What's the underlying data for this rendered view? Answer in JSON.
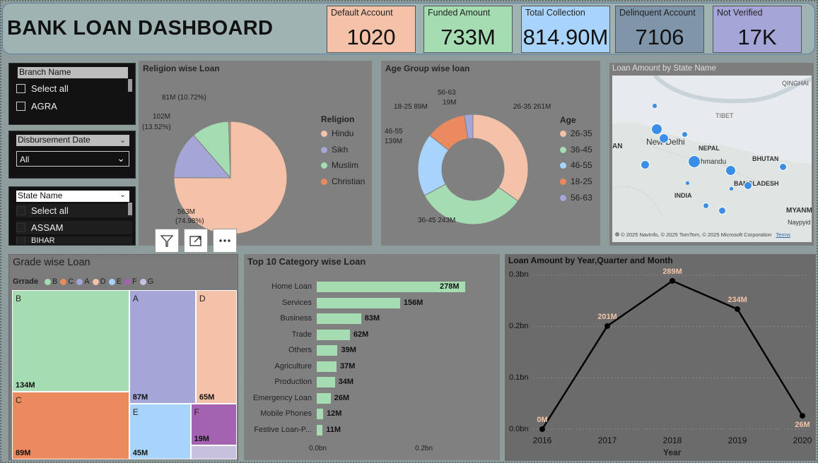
{
  "header": {
    "title": "BANK LOAN DASHBOARD"
  },
  "kpis": [
    {
      "label": "Default Account",
      "value": "1020",
      "color": "#f4c2a8"
    },
    {
      "label": "Funded Amount",
      "value": "733M",
      "color": "#a6dcb2"
    },
    {
      "label": "Total Collection",
      "value": "814.90M",
      "color": "#a8d4fb"
    },
    {
      "label": "Delinquent Account",
      "value": "7106",
      "color": "#7f95aa"
    },
    {
      "label": "Not Verified",
      "value": "17K",
      "color": "#a5a5d8"
    }
  ],
  "slicers": {
    "branch": {
      "header": "Branch Name",
      "items": [
        "Select all",
        "AGRA"
      ]
    },
    "date": {
      "header": "Disbursement Date",
      "value": "All"
    },
    "state": {
      "header": "State Name",
      "items": [
        "Select all",
        "ASSAM",
        "BIHAR"
      ]
    }
  },
  "religion_chart": {
    "title": "Religion wise Loan",
    "legend_title": "Religion",
    "labels": [
      "81M (10.72%)",
      "102M",
      "(13.52%)",
      "563M",
      "(74.98%)"
    ]
  },
  "age_chart": {
    "title": "Age Group wise loan",
    "legend_title": "Age",
    "labels": [
      "56-63",
      "19M",
      "18-25 89M",
      "26-35 261M",
      "46-55",
      "139M",
      "36-45 243M"
    ]
  },
  "map": {
    "title": "Loan Amount by State Name",
    "places": [
      "QINGHAI",
      "TIBET",
      "New Delhi",
      "NEPAL",
      "Kathmandu",
      "BHUTAN",
      "INDIA",
      "BANGLADESH",
      "Naypyid",
      "MYANM",
      "AN"
    ],
    "attribution": "© 2025 NavInfo, © 2025 TomTom, © 2025 Microsoft Corporation",
    "terms": "Terms"
  },
  "toolbar": {
    "filter": "filter-icon",
    "focus": "focus-mode-icon",
    "more": "more-options-icon"
  },
  "grade_chart": {
    "title": "Grade wise Loan",
    "legend_title": "Grrade"
  },
  "category_chart": {
    "title": "Top 10 Category wise Loan",
    "axis_ticks": [
      "0.0bn",
      "0.2bn"
    ]
  },
  "trend_chart": {
    "title": "Loan Amount by Year,Quarter and Month",
    "xlabel": "Year",
    "yticks": [
      "0.3bn",
      "0.2bn",
      "0.1bn",
      "0.0bn"
    ]
  },
  "chart_data": [
    {
      "type": "pie",
      "title": "Religion wise Loan",
      "categories": [
        "Hindu",
        "Sikh",
        "Muslim",
        "Christian"
      ],
      "values": [
        563,
        102,
        81,
        4
      ],
      "unit": "M",
      "colors": [
        "#f4c2a8",
        "#a5a5d8",
        "#a6dcb2",
        "#eb8a5e"
      ],
      "legend": "right"
    },
    {
      "type": "pie",
      "subtype": "donut",
      "title": "Age Group wise loan",
      "categories": [
        "26-35",
        "36-45",
        "46-55",
        "18-25",
        "56-63"
      ],
      "values": [
        261,
        243,
        139,
        89,
        19
      ],
      "unit": "M",
      "colors": [
        "#f4c2a8",
        "#a6dcb2",
        "#a8d4fb",
        "#eb8a5e",
        "#a5a5d8"
      ],
      "legend": "right"
    },
    {
      "type": "treemap",
      "title": "Grade wise Loan",
      "categories": [
        "B",
        "C",
        "A",
        "D",
        "E",
        "F",
        "G"
      ],
      "values": [
        134,
        89,
        87,
        65,
        45,
        19,
        6
      ],
      "labels": [
        "134M",
        "89M",
        "87M",
        "65M",
        "45M",
        "19M",
        ""
      ],
      "colors": [
        "#a6dcb2",
        "#eb8a5e",
        "#a5a5d8",
        "#f4c2a8",
        "#a8d4fb",
        "#a463b0",
        "#c7c1dd"
      ],
      "legend": "top"
    },
    {
      "type": "bar",
      "orientation": "horizontal",
      "title": "Top 10 Category wise Loan",
      "categories": [
        "Home Loan",
        "Services",
        "Business",
        "Trade",
        "Others",
        "Agriculture",
        "Production",
        "Emergency Loan",
        "Mobile Phones",
        "Festive Loan-P..."
      ],
      "values": [
        278,
        156,
        83,
        62,
        39,
        37,
        34,
        26,
        12,
        11
      ],
      "labels": [
        "278M",
        "156M",
        "83M",
        "62M",
        "39M",
        "37M",
        "34M",
        "26M",
        "12M",
        "11M"
      ],
      "xlim": [
        0,
        0.28
      ],
      "color": "#a6dcb2"
    },
    {
      "type": "line",
      "title": "Loan Amount by Year,Quarter and Month",
      "x": [
        "2016",
        "2017",
        "2018",
        "2019",
        "2020"
      ],
      "values": [
        0.0,
        0.201,
        0.289,
        0.234,
        0.026
      ],
      "labels": [
        "0M",
        "201M",
        "289M",
        "234M",
        "26M"
      ],
      "xlabel": "Year",
      "ylim": [
        0,
        0.3
      ],
      "grid": true
    }
  ]
}
